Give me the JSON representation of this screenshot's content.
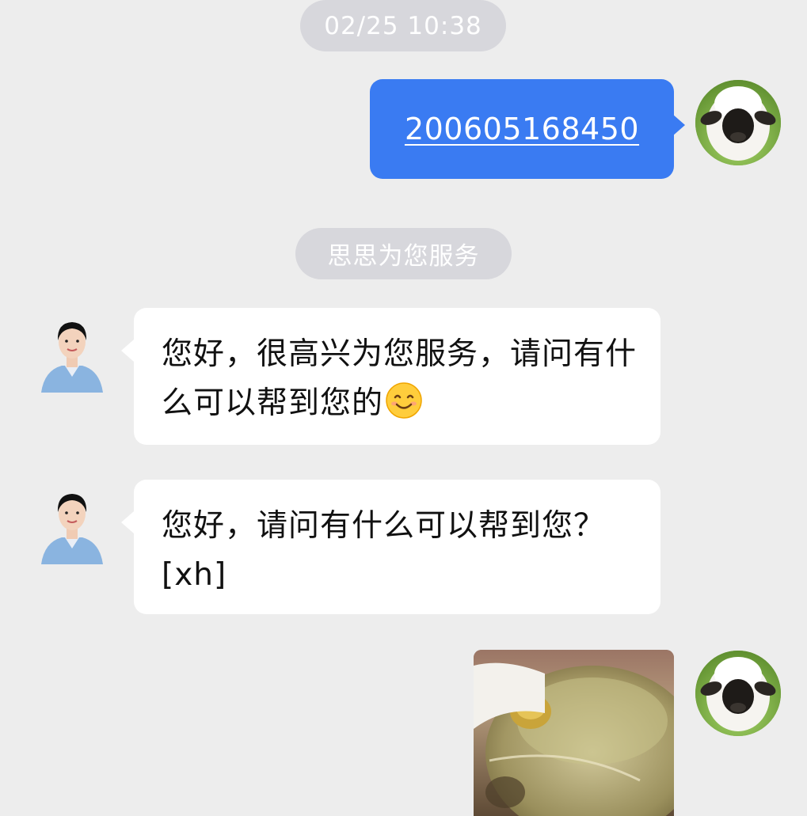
{
  "chat": {
    "timestamp": "02/25 10:38",
    "system_notice": "思思为您服务",
    "messages": [
      {
        "sender": "user",
        "type": "link",
        "text": "200605168450"
      },
      {
        "sender": "agent",
        "type": "text",
        "text": "您好，很高兴为您服务，请问有什么可以帮到您的",
        "emoji": "smiling-face-emoji"
      },
      {
        "sender": "agent",
        "type": "text",
        "text": "您好，请问有什么可以帮到您？[xh]"
      },
      {
        "sender": "user",
        "type": "image",
        "image_icon": "glass-bowl-photo"
      }
    ]
  },
  "avatars": {
    "user": "sheep-avatar",
    "agent": "agent-avatar"
  },
  "colors": {
    "background": "#ededed",
    "user_bubble": "#3a7bf2",
    "agent_bubble": "#ffffff",
    "notice_pill": "#d7d7dc"
  }
}
